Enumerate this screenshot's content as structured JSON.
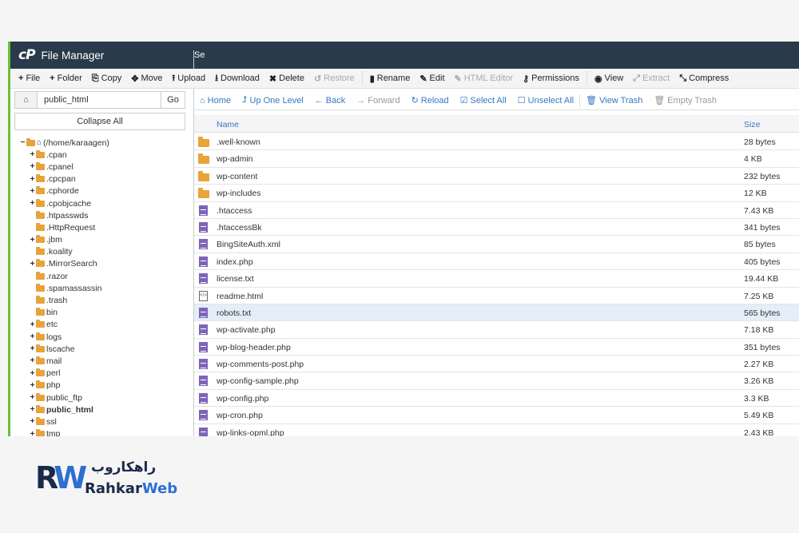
{
  "titlebar": {
    "logo": "cP",
    "title": "File Manager",
    "right_text": "Se"
  },
  "toolbar": [
    {
      "icon": "+",
      "label": "File",
      "disabled": false
    },
    {
      "icon": "+",
      "label": "Folder",
      "disabled": false
    },
    {
      "icon": "⎘",
      "label": "Copy",
      "disabled": false
    },
    {
      "icon": "✥",
      "label": "Move",
      "disabled": false
    },
    {
      "icon": "⭱",
      "label": "Upload",
      "disabled": false
    },
    {
      "icon": "⭳",
      "label": "Download",
      "disabled": false
    },
    {
      "icon": "✖",
      "label": "Delete",
      "disabled": false
    },
    {
      "icon": "↺",
      "label": "Restore",
      "disabled": true
    },
    {
      "icon": "▮",
      "label": "Rename",
      "disabled": false
    },
    {
      "icon": "✎",
      "label": "Edit",
      "disabled": false
    },
    {
      "icon": "✎",
      "label": "HTML Editor",
      "disabled": true
    },
    {
      "icon": "⚷",
      "label": "Permissions",
      "disabled": false
    },
    {
      "icon": "◉",
      "label": "View",
      "disabled": false
    },
    {
      "icon": "⤢",
      "label": "Extract",
      "disabled": true
    },
    {
      "icon": "⤡",
      "label": "Compress",
      "disabled": false
    }
  ],
  "left": {
    "path_value": "public_html",
    "go_label": "Go",
    "collapse_label": "Collapse All",
    "root_label": "(/home/karaagen)",
    "tree": [
      {
        "label": ".cpan",
        "expandable": true,
        "bold": false
      },
      {
        "label": ".cpanel",
        "expandable": true,
        "bold": false
      },
      {
        "label": ".cpcpan",
        "expandable": true,
        "bold": false
      },
      {
        "label": ".cphorde",
        "expandable": true,
        "bold": false
      },
      {
        "label": ".cpobjcache",
        "expandable": true,
        "bold": false
      },
      {
        "label": ".htpasswds",
        "expandable": false,
        "bold": false
      },
      {
        "label": ".HttpRequest",
        "expandable": false,
        "bold": false
      },
      {
        "label": ".jbm",
        "expandable": true,
        "bold": false
      },
      {
        "label": ".koality",
        "expandable": false,
        "bold": false
      },
      {
        "label": ".MirrorSearch",
        "expandable": true,
        "bold": false
      },
      {
        "label": ".razor",
        "expandable": false,
        "bold": false
      },
      {
        "label": ".spamassassin",
        "expandable": false,
        "bold": false
      },
      {
        "label": ".trash",
        "expandable": false,
        "bold": false
      },
      {
        "label": "bin",
        "expandable": false,
        "bold": false
      },
      {
        "label": "etc",
        "expandable": true,
        "bold": false
      },
      {
        "label": "logs",
        "expandable": true,
        "bold": false
      },
      {
        "label": "lscache",
        "expandable": true,
        "bold": false
      },
      {
        "label": "mail",
        "expandable": true,
        "bold": false
      },
      {
        "label": "perl",
        "expandable": true,
        "bold": false
      },
      {
        "label": "php",
        "expandable": true,
        "bold": false
      },
      {
        "label": "public_ftp",
        "expandable": true,
        "bold": false
      },
      {
        "label": "public_html",
        "expandable": true,
        "bold": true
      },
      {
        "label": "ssl",
        "expandable": true,
        "bold": false
      },
      {
        "label": "tmp",
        "expandable": true,
        "bold": false
      }
    ]
  },
  "nav": [
    {
      "icon": "⌂",
      "label": "Home",
      "disabled": false
    },
    {
      "icon": "⮥",
      "label": "Up One Level",
      "disabled": false
    },
    {
      "icon": "←",
      "label": "Back",
      "disabled": false
    },
    {
      "icon": "→",
      "label": "Forward",
      "disabled": true
    },
    {
      "icon": "↻",
      "label": "Reload",
      "disabled": false
    },
    {
      "icon": "☑",
      "label": "Select All",
      "disabled": false
    },
    {
      "icon": "☐",
      "label": "Unselect All",
      "disabled": false
    },
    {
      "icon": "🗑",
      "label": "View Trash",
      "disabled": false
    },
    {
      "icon": "🗑",
      "label": "Empty Trash",
      "disabled": true
    }
  ],
  "table": {
    "headers": {
      "name": "Name",
      "size": "Size"
    },
    "rows": [
      {
        "type": "folder",
        "name": ".well-known",
        "size": "28 bytes",
        "selected": false
      },
      {
        "type": "folder",
        "name": "wp-admin",
        "size": "4 KB",
        "selected": false
      },
      {
        "type": "folder",
        "name": "wp-content",
        "size": "232 bytes",
        "selected": false
      },
      {
        "type": "folder",
        "name": "wp-includes",
        "size": "12 KB",
        "selected": false
      },
      {
        "type": "file",
        "name": ".htaccess",
        "size": "7.43 KB",
        "selected": false
      },
      {
        "type": "file",
        "name": ".htaccessBk",
        "size": "341 bytes",
        "selected": false
      },
      {
        "type": "file",
        "name": "BingSiteAuth.xml",
        "size": "85 bytes",
        "selected": false
      },
      {
        "type": "file",
        "name": "index.php",
        "size": "405 bytes",
        "selected": false
      },
      {
        "type": "file",
        "name": "license.txt",
        "size": "19.44 KB",
        "selected": false
      },
      {
        "type": "html",
        "name": "readme.html",
        "size": "7.25 KB",
        "selected": false
      },
      {
        "type": "file",
        "name": "robots.txt",
        "size": "565 bytes",
        "selected": true
      },
      {
        "type": "file",
        "name": "wp-activate.php",
        "size": "7.18 KB",
        "selected": false
      },
      {
        "type": "file",
        "name": "wp-blog-header.php",
        "size": "351 bytes",
        "selected": false
      },
      {
        "type": "file",
        "name": "wp-comments-post.php",
        "size": "2.27 KB",
        "selected": false
      },
      {
        "type": "file",
        "name": "wp-config-sample.php",
        "size": "3.26 KB",
        "selected": false
      },
      {
        "type": "file",
        "name": "wp-config.php",
        "size": "3.3 KB",
        "selected": false
      },
      {
        "type": "file",
        "name": "wp-cron.php",
        "size": "5.49 KB",
        "selected": false
      },
      {
        "type": "file",
        "name": "wp-links-opml.php",
        "size": "2.43 KB",
        "selected": false
      }
    ]
  },
  "brand": {
    "mark_r": "R",
    "mark_w": "W",
    "persian": "راهکاروب",
    "name_a": "Rahkar",
    "name_b": "Web"
  },
  "colors": {
    "titlebar": "#293a4a",
    "accent_green": "#6cbf3c",
    "link_blue": "#3578c4",
    "folder": "#e8a33b",
    "file": "#7e64b8",
    "brand_dark": "#1b2a4a",
    "brand_blue": "#2d6fd0"
  }
}
